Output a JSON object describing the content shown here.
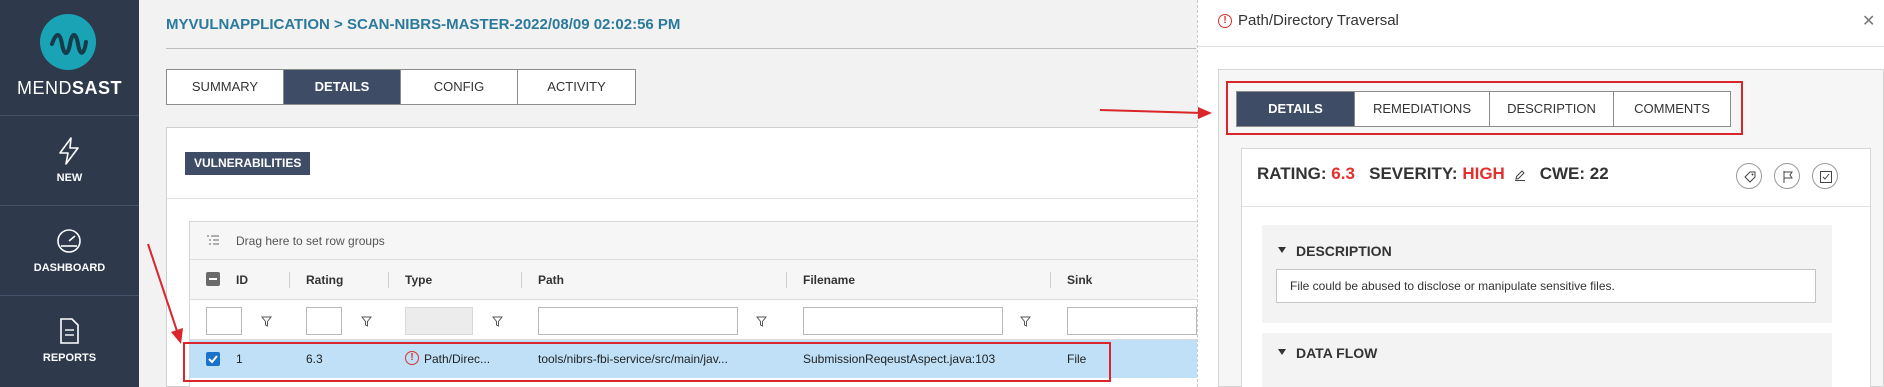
{
  "sidebar": {
    "logo": {
      "prefix": "MEND",
      "suffix": "SAST"
    },
    "items": [
      {
        "label": "NEW",
        "icon": "bolt-icon"
      },
      {
        "label": "DASHBOARD",
        "icon": "gauge-icon"
      },
      {
        "label": "REPORTS",
        "icon": "report-icon"
      }
    ]
  },
  "breadcrumb": "MYVULNAPPLICATION > SCAN-NIBRS-MASTER-2022/08/09 02:02:56 PM",
  "main_tabs": [
    "SUMMARY",
    "DETAILS",
    "CONFIG",
    "ACTIVITY"
  ],
  "main_tabs_active": "DETAILS",
  "vulnerabilities_label": "VULNERABILITIES",
  "grid": {
    "group_hint": "Drag here to set row groups",
    "columns": [
      "ID",
      "Rating",
      "Type",
      "Path",
      "Filename",
      "Sink"
    ],
    "rows": [
      {
        "checked": true,
        "id": "1",
        "rating": "6.3",
        "type": "Path/Direc...",
        "path": "tools/nibrs-fbi-service/src/main/jav...",
        "filename": "SubmissionReqeustAspect.java:103",
        "sink": "File"
      }
    ]
  },
  "drawer": {
    "title": "Path/Directory Traversal",
    "tabs": [
      "DETAILS",
      "REMEDIATIONS",
      "DESCRIPTION",
      "COMMENTS"
    ],
    "active_tab": "DETAILS",
    "rating_label": "RATING:",
    "rating_value": "6.3",
    "severity_label": "SEVERITY:",
    "severity_value": "HIGH",
    "cwe": "CWE: 22",
    "sections": [
      {
        "title": "DESCRIPTION",
        "text": "File could be abused to disclose or manipulate sensitive files."
      },
      {
        "title": "DATA FLOW"
      }
    ]
  },
  "colors": {
    "sidebar": "#2e3a4b",
    "accent": "#3e4c66",
    "link": "#2b7a9c",
    "severity": "#e0312f",
    "row_selected": "#bfe0f7",
    "annotation": "#d9262a"
  }
}
